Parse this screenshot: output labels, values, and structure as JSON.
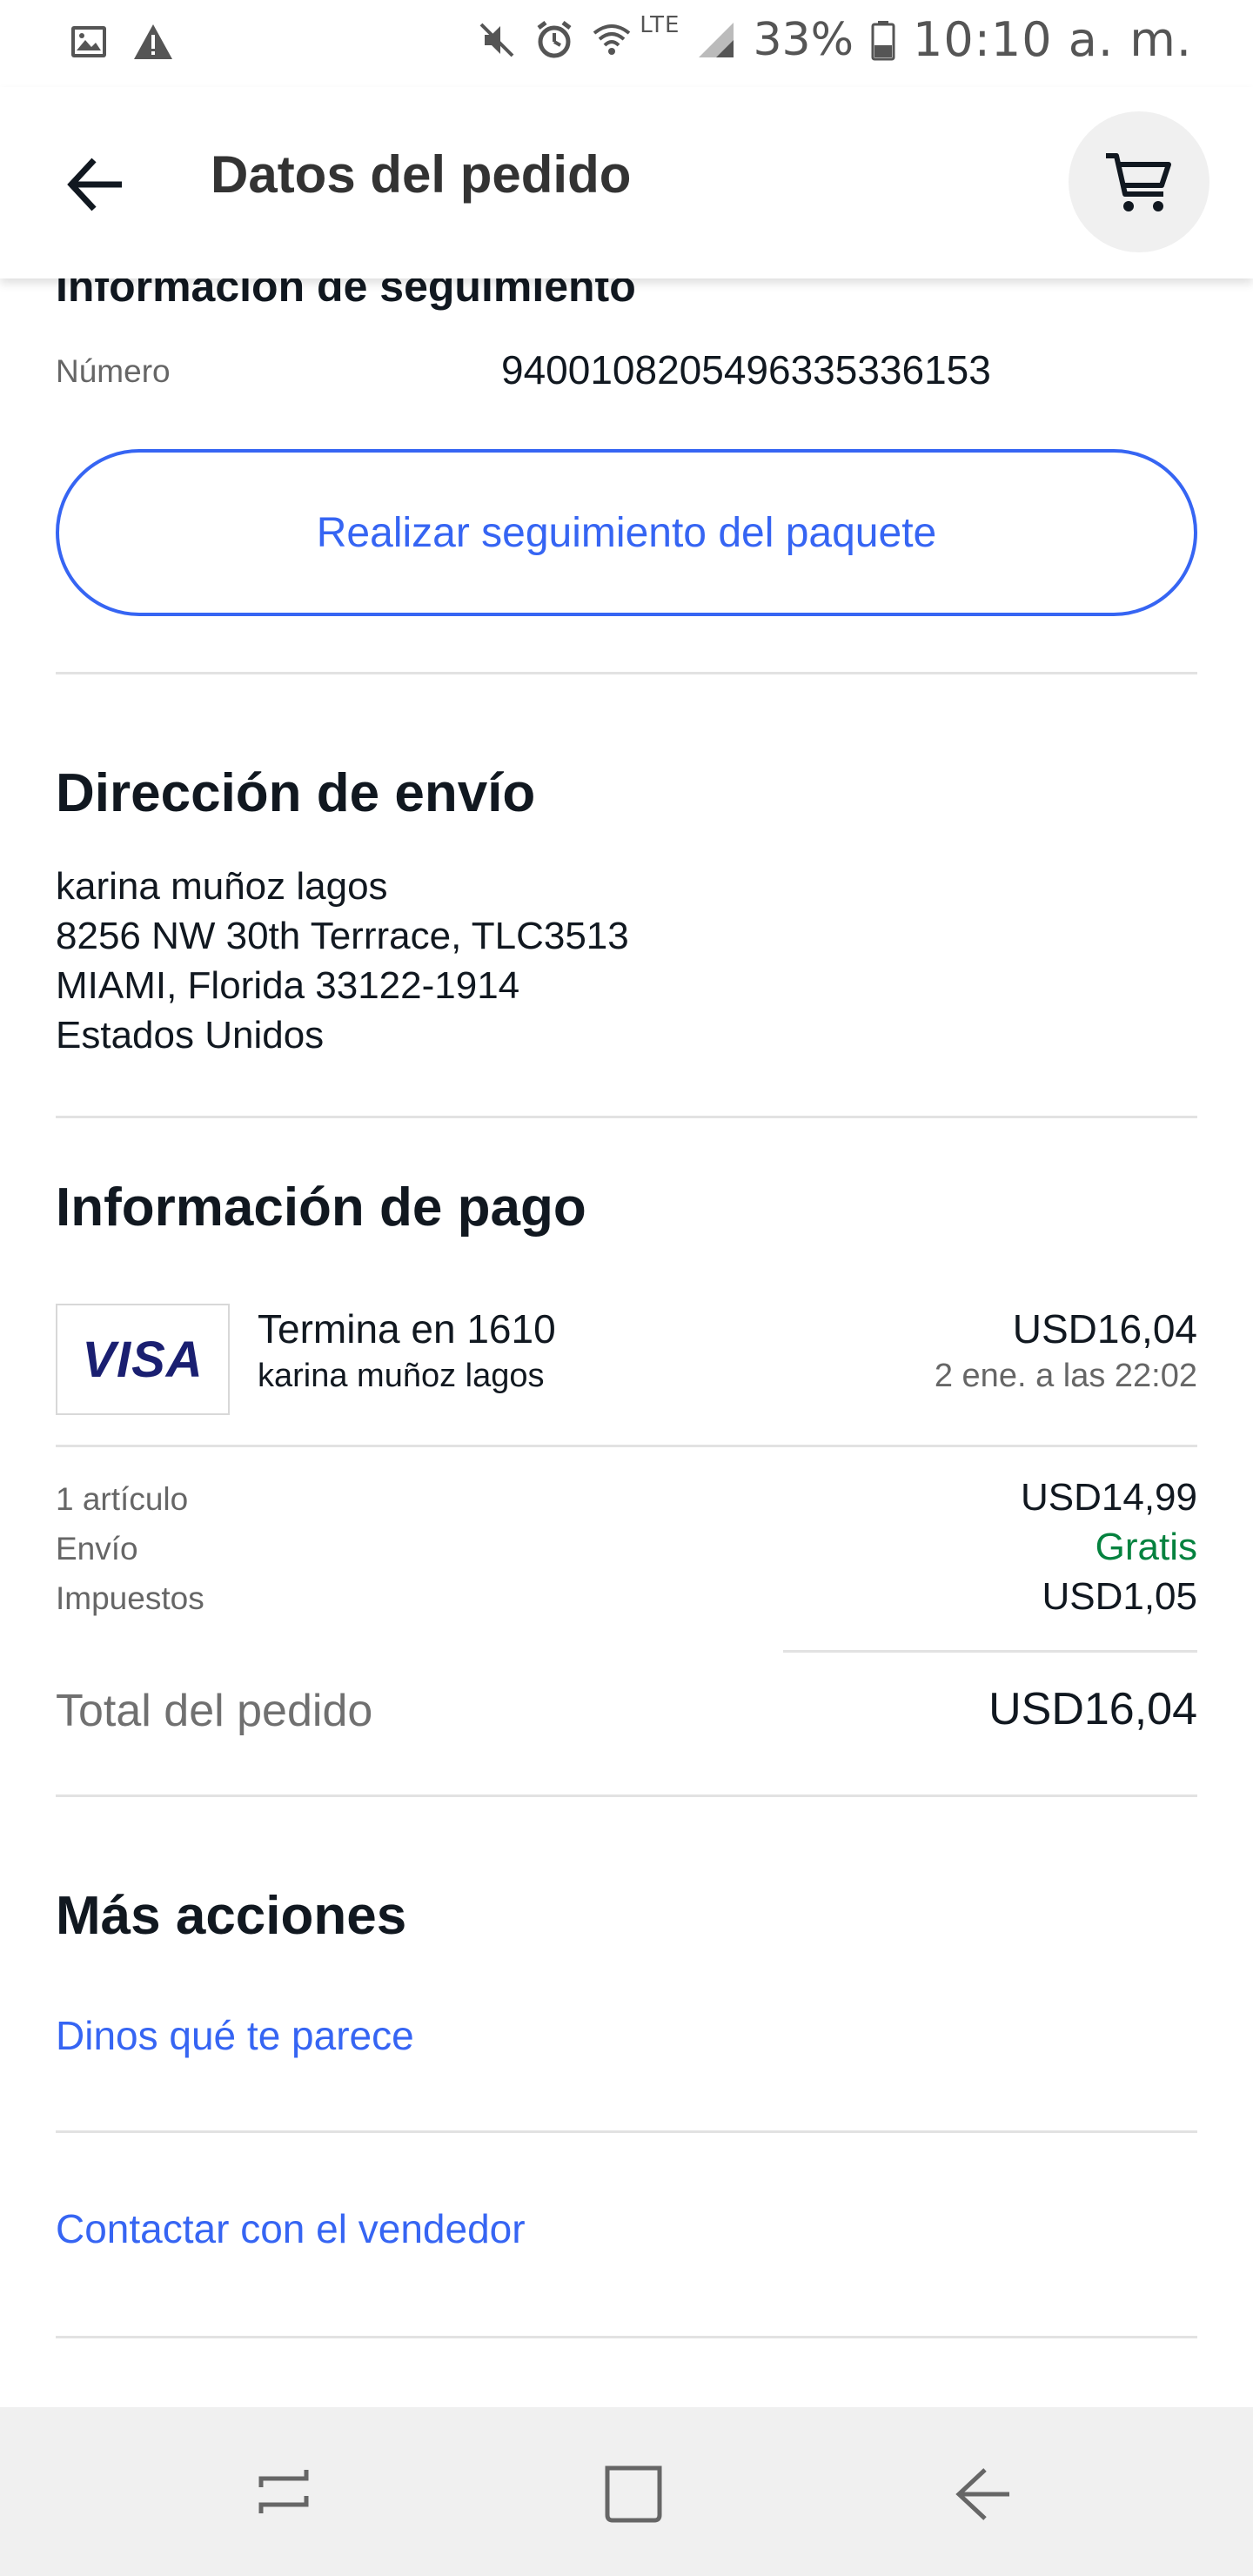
{
  "status_bar": {
    "battery": "33%",
    "time": "10:10 a. m.",
    "network": "LTE"
  },
  "app_bar": {
    "title": "Datos del pedido"
  },
  "tracking": {
    "section_title": "Información de seguimiento",
    "number_label": "Número",
    "number_value": "9400108205496335336153",
    "track_button": "Realizar seguimiento del paquete"
  },
  "shipping": {
    "title": "Dirección de envío",
    "lines": [
      "karina muñoz lagos",
      "8256 NW 30th Terrrace, TLC3513",
      "MIAMI, Florida 33122-1914",
      "Estados Unidos"
    ]
  },
  "payment": {
    "title": "Información de pago",
    "card_brand": "VISA",
    "card_ending": "Termina en 1610",
    "card_holder": "karina muñoz lagos",
    "amount": "USD16,04",
    "date": "2 ene. a las 22:02"
  },
  "summary": {
    "items": [
      {
        "label": "1 artículo",
        "value": "USD14,99"
      },
      {
        "label": "Envío",
        "value": "Gratis"
      },
      {
        "label": "Impuestos",
        "value": "USD1,05"
      }
    ],
    "total_label": "Total del pedido",
    "total_value": "USD16,04"
  },
  "more_actions": {
    "title": "Más acciones",
    "links": [
      "Dinos qué te parece",
      "Contactar con el vendedor"
    ]
  },
  "colors": {
    "link_blue": "#3665f3",
    "free_green": "#05823f",
    "visa_navy": "#1a1f71"
  }
}
